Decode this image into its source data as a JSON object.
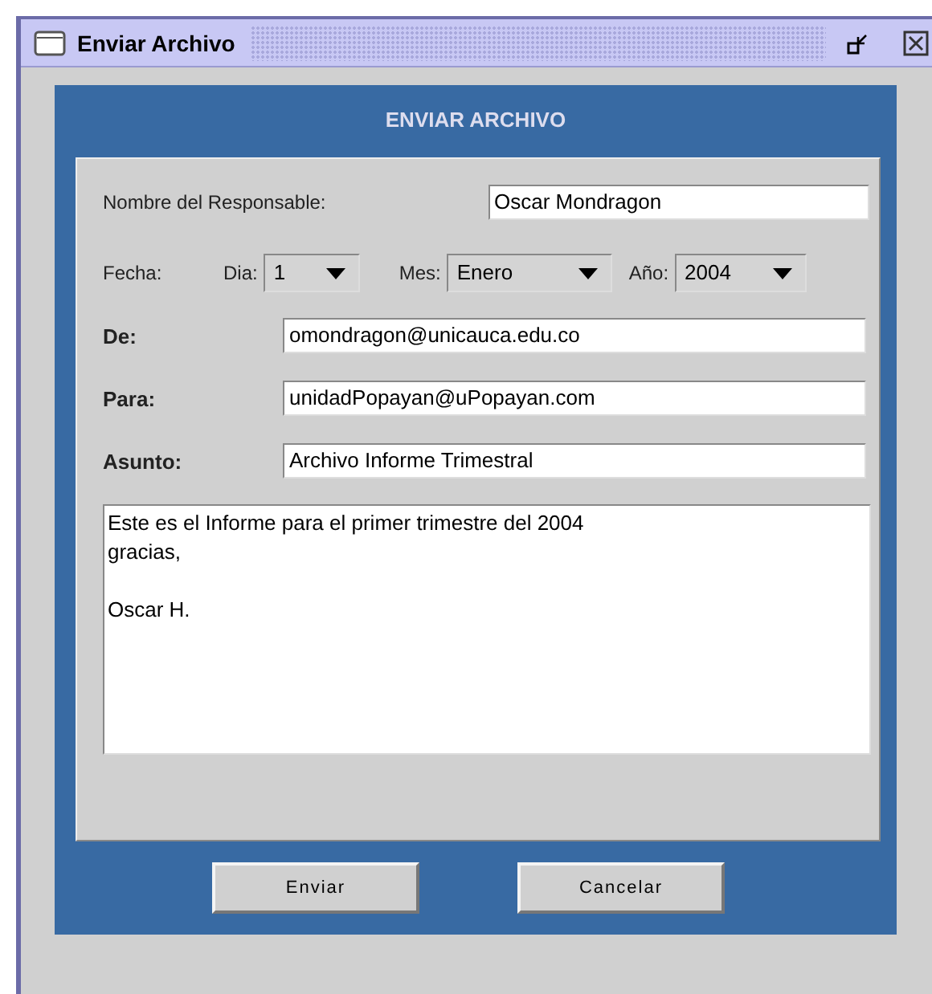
{
  "window": {
    "title": "Enviar Archivo"
  },
  "form": {
    "heading": "ENVIAR ARCHIVO",
    "responsable": {
      "label": "Nombre del Responsable:",
      "value": "Oscar Mondragon"
    },
    "fecha": {
      "label": "Fecha:",
      "parts": [
        {
          "label": "Dia:",
          "value": "1"
        },
        {
          "label": "Mes:",
          "value": "Enero"
        },
        {
          "label": "Año:",
          "value": "2004"
        }
      ]
    },
    "address_fields": [
      {
        "label": "De:",
        "value": "omondragon@unicauca.edu.co"
      },
      {
        "label": "Para:",
        "value": "unidadPopayan@uPopayan.com"
      },
      {
        "label": "Asunto:",
        "value": "Archivo Informe Trimestral"
      }
    ],
    "message": "Este es el Informe para el primer trimestre del 2004\ngracias,\n\nOscar H."
  },
  "buttons": [
    "Enviar",
    "Cancelar"
  ]
}
